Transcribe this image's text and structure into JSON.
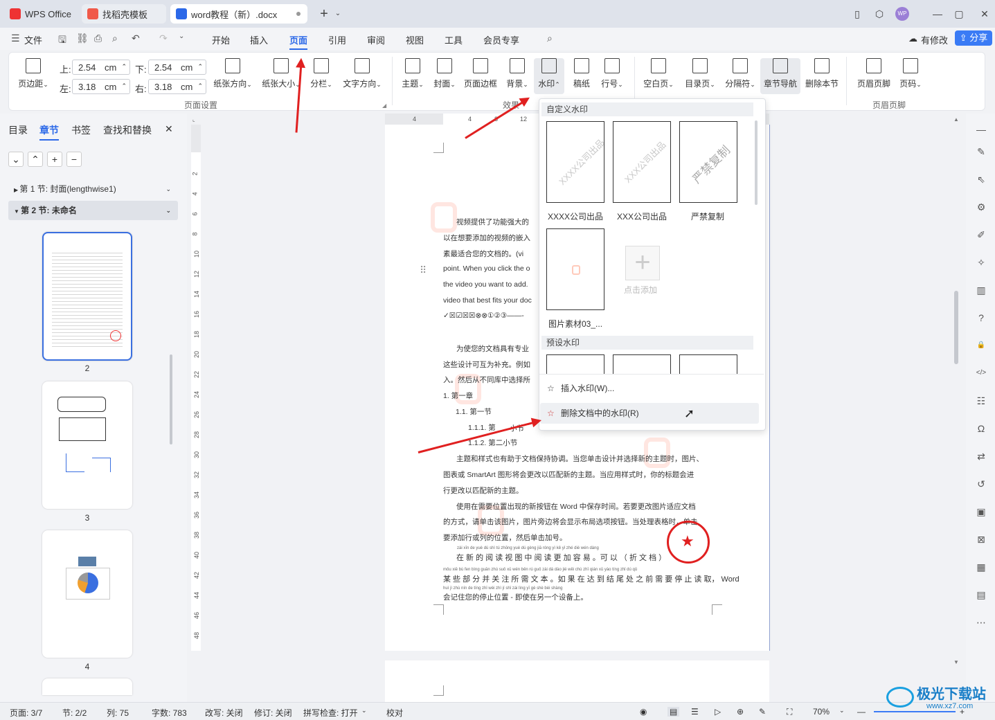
{
  "titlebar": {
    "tabs": [
      {
        "label": "WPS Office"
      },
      {
        "label": "找稻壳模板"
      },
      {
        "label": "word教程（新）.docx"
      }
    ],
    "user_badge": "WP"
  },
  "menubar": {
    "file_label": "文件",
    "items": [
      "开始",
      "插入",
      "页面",
      "引用",
      "审阅",
      "视图",
      "工具",
      "会员专享"
    ],
    "active": "页面",
    "has_changes": "有修改",
    "share": "分享"
  },
  "ribbon": {
    "margins": {
      "top_label": "上:",
      "top_value": "2.54",
      "bottom_label": "下:",
      "bottom_value": "2.54",
      "left_label": "左:",
      "left_value": "3.18",
      "right_label": "右:",
      "right_value": "3.18",
      "unit": "cm"
    },
    "buttons": [
      "页边距",
      "纸张方向",
      "纸张大小",
      "分栏",
      "文字方向",
      "主题",
      "封面",
      "页面边框",
      "背景",
      "水印",
      "稿纸",
      "行号",
      "空白页",
      "目录页",
      "分隔符",
      "章节导航",
      "删除本节",
      "页眉页脚",
      "页码"
    ],
    "groups": [
      "页面设置",
      "效果",
      "页眉页脚"
    ]
  },
  "leftpane": {
    "tabs": [
      "目录",
      "章节",
      "书签",
      "查找和替换"
    ],
    "active_tab": "章节",
    "sections": [
      {
        "label": "第 1 节: 封面(lengthwise1)"
      },
      {
        "label": "第 2 节: 未命名"
      }
    ],
    "page_numbers": [
      "2",
      "3",
      "4"
    ]
  },
  "ruler": {
    "h": [
      "4",
      "4",
      "8",
      "12"
    ],
    "v": [
      "2",
      "4",
      "6",
      "8",
      "10",
      "12",
      "14",
      "16",
      "18",
      "20",
      "22",
      "24",
      "26",
      "28",
      "30",
      "32",
      "34",
      "36",
      "38",
      "40",
      "42",
      "44",
      "46",
      "48"
    ]
  },
  "document": {
    "lines": [
      "视频提供了功能强大的",
      "以在想要添加的视频的嵌入",
      "素最适合您的文档的。(vi",
      "point. When you click the o",
      "the video you want to add.",
      "video that best fits your doc",
      "✓☒☑☒☒⊗⊗①②③——-",
      "为使您的文档具有专业",
      "这些设计可互为补充。例如",
      "入。然后从不同库中选择所",
      "1.    第一章",
      "1.1.  第一节",
      "1.1.1.   第",
      "1.1.2.   第二小节",
      "主题和样式也有助于文档保持协调。当您单击设计并选择新的主题时，图片、",
      "图表或 SmartArt 图形将会更改以匹配新的主题。当应用样式时，你的标题会进",
      "行更改以匹配新的主题。",
      "使用在需要位置出现的新按钮在 Word 中保存时间。若要更改图片适应文档",
      "的方式，请单击该图片，图片旁边将会显示布局选项按钮。当处理表格时，单击",
      "要添加行或列的位置，然后单击加号。",
      "在 新 的 阅 读 视 图 中 阅 读 更 加 容 易 。可 以 （ 折   文   档 ）",
      "某 些 部 分 并 关 注 所 需 文 本 。如 果 在 达 到 结 尾 处 之 前 需 要 停 止 读 取， Word",
      "会记住您的停止位置 - 即使在另一个设备上。"
    ],
    "pinyin1": "zài xīn de yuè dú shì tú zhōng yuè dú gèng jiā róng yì kě yǐ zhé dié wén dàng",
    "pinyin2": "mǒu xiē bù fen bìng guān zhù suǒ xū wén běn rú guǒ zài dá dào jié wěi chù zhī qián xū yào tíng zhǐ dú qǔ",
    "pinyin3": "huì jì zhù nín de tíng zhǐ wèi zhì jí shǐ zài lìng yī gè shè bèi shàng",
    "overlap_fragment": "小节"
  },
  "watermark_menu": {
    "custom_header": "自定义水印",
    "custom": [
      {
        "label": "XXXX公司出品",
        "mark": "XXXX公司出品"
      },
      {
        "label": "XXX公司出品",
        "mark": "XXX公司出品"
      },
      {
        "label": "严禁复制",
        "mark": "严禁复制"
      },
      {
        "label": "图片素材03_...",
        "mark": ""
      }
    ],
    "add_label": "点击添加",
    "preset_header": "预设水印",
    "insert": "插入水印(W)...",
    "delete": "删除文档中的水印(R)"
  },
  "statusbar": {
    "page": "页面: 3/7",
    "section": "节: 2/2",
    "column": "列: 75",
    "words": "字数: 783",
    "overtype": "改写: 关闭",
    "revision": "修订: 关闭",
    "spell": "拼写检查: 打开",
    "proof": "校对",
    "zoom": "70%"
  },
  "site_watermark": {
    "title": "极光下载站",
    "url": "www.xz7.com"
  },
  "colors": {
    "accent": "#3a7bf5",
    "arrow": "#e02020",
    "seal": "#e02020"
  }
}
